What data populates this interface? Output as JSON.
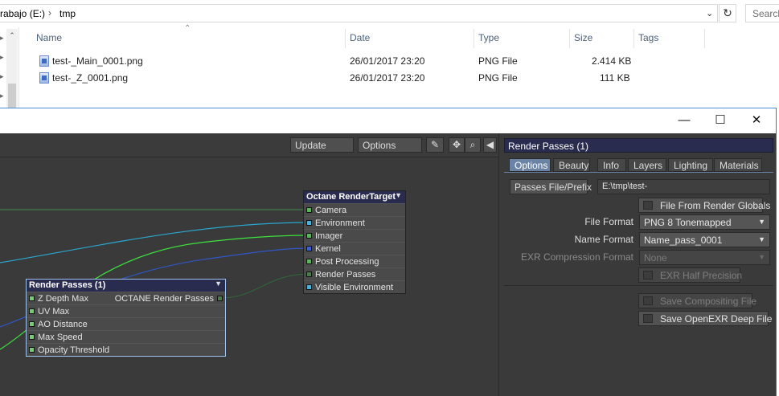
{
  "explorer": {
    "address_drive": "rabajo (E:)",
    "address_folder": "tmp",
    "search_placeholder": "Search",
    "columns": {
      "name": "Name",
      "date": "Date",
      "type": "Type",
      "size": "Size",
      "tags": "Tags"
    },
    "files": [
      {
        "name": "test-_Main_0001.png",
        "date": "26/01/2017 23:20",
        "type": "PNG File",
        "size": "2.414 KB"
      },
      {
        "name": "test-_Z_0001.png",
        "date": "26/01/2017 23:20",
        "type": "PNG File",
        "size": "111 KB"
      }
    ]
  },
  "node_window": {
    "controls": {
      "minimize": "—",
      "maximize": "☐",
      "close": "✕"
    },
    "toolbar": {
      "update_label": "Update",
      "options_label": "Options",
      "pen_icon": "✎",
      "move_icon": "✥",
      "zoom_icon": "⌕",
      "collapse_icon": "◀"
    },
    "nodes": {
      "render_target": {
        "title": "Octane RenderTarget",
        "inputs": [
          {
            "label": "Camera",
            "color": "#5fb35f"
          },
          {
            "label": "Environment",
            "color": "#4bb0d6"
          },
          {
            "label": "Imager",
            "color": "#5fb35f"
          },
          {
            "label": "Kernel",
            "color": "#3e5fd0"
          },
          {
            "label": "Post Processing",
            "color": "#5fb35f"
          },
          {
            "label": "Render Passes",
            "color": "#4b7a4b"
          },
          {
            "label": "Visible Environment",
            "color": "#4bb0d6"
          }
        ]
      },
      "render_passes": {
        "title": "Render Passes (1)",
        "output": "OCTANE Render Passes",
        "inputs": [
          {
            "label": "Z Depth Max",
            "color": "#6fd06f"
          },
          {
            "label": "UV Max",
            "color": "#6fd06f"
          },
          {
            "label": "AO Distance",
            "color": "#6fd06f"
          },
          {
            "label": "Max Speed",
            "color": "#6fd06f"
          },
          {
            "label": "Opacity Threshold",
            "color": "#6fd06f"
          }
        ]
      }
    },
    "wire_colors": {
      "camera": "#3f8f4f",
      "environment": "#2aa7cf",
      "imager": "#3de23d",
      "kernel": "#2f57c8",
      "render_passes": "#2f6a3a"
    },
    "panel": {
      "title": "Render Passes (1)",
      "tabs": [
        "Options",
        "Beauty",
        "Info",
        "Layers",
        "Lighting",
        "Materials"
      ],
      "active_tab": "Options",
      "passes_file_label": "Passes File/Prefix",
      "passes_file_value": "E:\\tmp\\test-",
      "file_from_globals": "File From Render Globals",
      "file_format_label": "File Format",
      "file_format_value": "PNG 8 Tonemapped",
      "name_format_label": "Name Format",
      "name_format_value": "Name_pass_0001",
      "exr_compression_label": "EXR Compression Format",
      "exr_compression_value": "None",
      "exr_half_precision": "EXR Half Precision",
      "save_compositing": "Save Compositing File",
      "save_openexr_deep": "Save OpenEXR Deep File"
    }
  }
}
